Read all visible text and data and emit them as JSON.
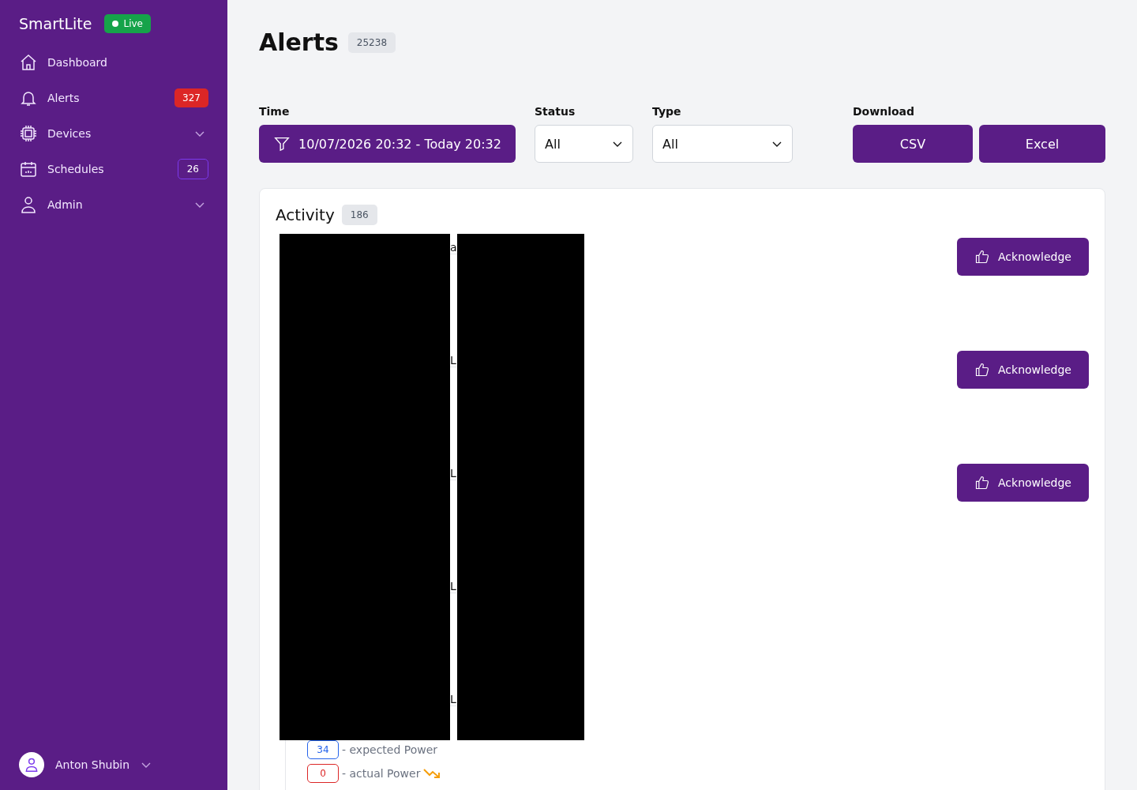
{
  "sidebar": {
    "brand": "SmartLite",
    "live_badge": "Live",
    "items": [
      {
        "kind": "home",
        "label": "Dashboard",
        "selected": false
      },
      {
        "kind": "bell",
        "label": "Alerts",
        "badge": {
          "kind": "filled",
          "text": "327"
        },
        "selected": false
      },
      {
        "kind": "chip",
        "label": "Devices",
        "expandable": true,
        "selected": false
      },
      {
        "kind": "calendar",
        "label": "Schedules",
        "badge": {
          "kind": "outline",
          "text": "26"
        },
        "selected": false
      },
      {
        "kind": "person",
        "label": "Admin",
        "expandable": true,
        "selected": false
      }
    ],
    "user": {
      "name": "Anton Shubin"
    }
  },
  "page": {
    "title": "Alerts",
    "count": "25238"
  },
  "filters": {
    "time": {
      "label": "Time",
      "value": "10/07/2026 20:32 - Today 20:32"
    },
    "status": {
      "label": "Status",
      "value": "All"
    },
    "type": {
      "label": "Type",
      "value": "All"
    },
    "download": {
      "label": "Download",
      "buttons": [
        "CSV",
        "Excel"
      ]
    }
  },
  "activity": {
    "title": "Activity",
    "count": "186",
    "rows": [
      {
        "fragment": "a",
        "action": "Acknowledge"
      },
      {
        "fragment": "L",
        "action": "Acknowledge"
      },
      {
        "fragment": "L",
        "action": "Acknowledge"
      },
      {
        "fragment": "L"
      },
      {
        "fragment": "L"
      }
    ],
    "legend": [
      {
        "value": "34",
        "text": "- expected Power",
        "color": "#2563eb"
      },
      {
        "value": "0",
        "text": "- actual Power",
        "color": "#dc2626",
        "trending_down": true
      }
    ]
  }
}
